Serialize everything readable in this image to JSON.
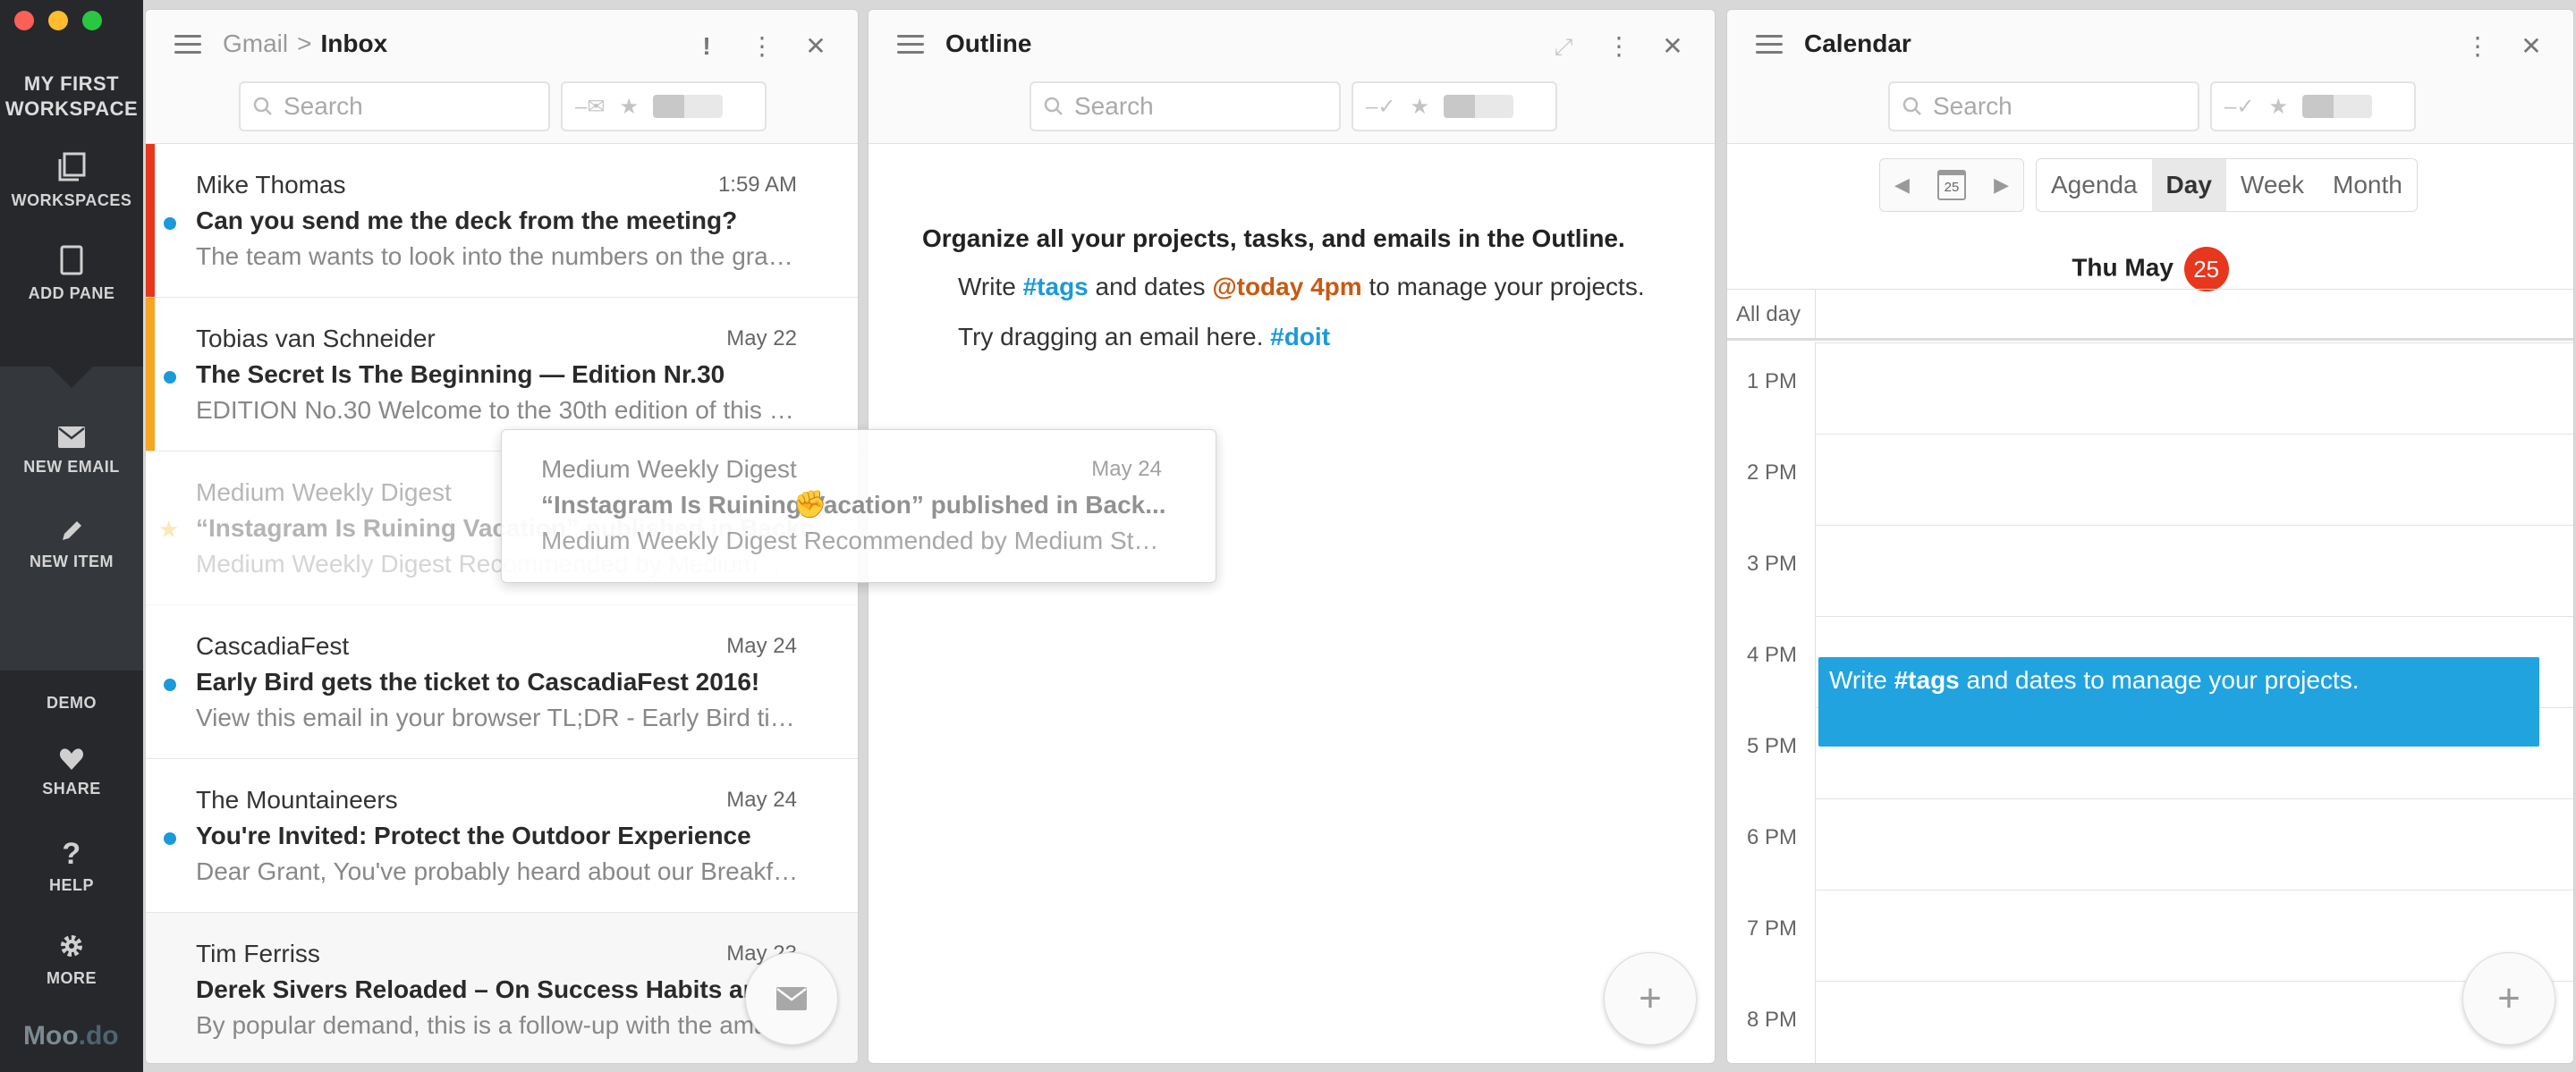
{
  "sidebar": {
    "workspace_title_line1": "MY FIRST",
    "workspace_title_line2": "WORKSPACE",
    "workspaces_label": "WORKSPACES",
    "add_pane_label": "ADD PANE",
    "new_email_label": "NEW EMAIL",
    "new_item_label": "NEW ITEM",
    "demo_label": "DEMO",
    "share_label": "SHARE",
    "help_label": "HELP",
    "more_label": "MORE",
    "logo_part1": "Moo",
    "logo_part2": ".do"
  },
  "inbox": {
    "breadcrumb_root": "Gmail",
    "breadcrumb_sep": ">",
    "title": "Inbox",
    "search_placeholder": "Search",
    "emails": [
      {
        "from": "Mike Thomas",
        "date": "1:59 AM",
        "subject": "Can you send me the deck from the meeting?",
        "snippet": "The team wants to look into the numbers on the graph and see if we can...",
        "bar_color": "#e8371c"
      },
      {
        "from": "Tobias van Schneider",
        "date": "May 22",
        "subject": "The Secret Is The Beginning  — Edition Nr.30",
        "snippet": "EDITION No.30 Welcome to the 30th edition of this newsletter...",
        "bar_color": "#f5a623"
      },
      {
        "from": "Medium Weekly Digest",
        "date": "May 24",
        "subject": "“Instagram Is Ruining Vacation” published in Backchannel",
        "snippet": "Medium Weekly Digest Recommended by Medium Staff..."
      },
      {
        "from": "CascadiaFest",
        "date": "May 24",
        "subject": "Early Bird gets the ticket to CascadiaFest 2016!",
        "snippet": "View this email in your browser TL;DR - Early Bird tickets are on sale..."
      },
      {
        "from": "The Mountaineers",
        "date": "May 24",
        "subject": "You're Invited: Protect the Outdoor Experience",
        "snippet": "Dear Grant, You've probably heard about our Breakfast..."
      },
      {
        "from": "Tim Ferriss",
        "date": "May 23",
        "subject": "Derek Sivers Reloaded – On Success Habits and",
        "snippet": "By popular demand, this is a follow-up with the amazing..."
      }
    ],
    "drag_card": {
      "from": "Medium Weekly Digest",
      "date": "May 24",
      "subject": "“Instagram Is Ruining Vacation” published in Back...",
      "snippet": "Medium Weekly Digest Recommended by Medium Staff..."
    }
  },
  "outline": {
    "title": "Outline",
    "search_placeholder": "Search",
    "heading": "Organize all your projects, tasks, and emails in the Outline.",
    "p1_a": "Write ",
    "p1_tag": "#tags",
    "p1_b": " and dates ",
    "p1_date": "@today 4pm",
    "p1_c": " to manage your projects.",
    "p2_a": "Try dragging an email here. ",
    "p2_tag": "#doit"
  },
  "calendar": {
    "title": "Calendar",
    "search_placeholder": "Search",
    "nav_day_num": "25",
    "views": [
      "Agenda",
      "Day",
      "Week",
      "Month"
    ],
    "active_view": "Day",
    "date_label": "Thu May",
    "date_badge": "25",
    "allday_label": "All day",
    "hours": [
      "1 PM",
      "2 PM",
      "3 PM",
      "4 PM",
      "5 PM",
      "6 PM",
      "7 PM",
      "8 PM"
    ],
    "event": {
      "a": "Write ",
      "tag": "#tags",
      "b": " and dates to manage your projects.",
      "start_hour": "4 PM"
    }
  }
}
